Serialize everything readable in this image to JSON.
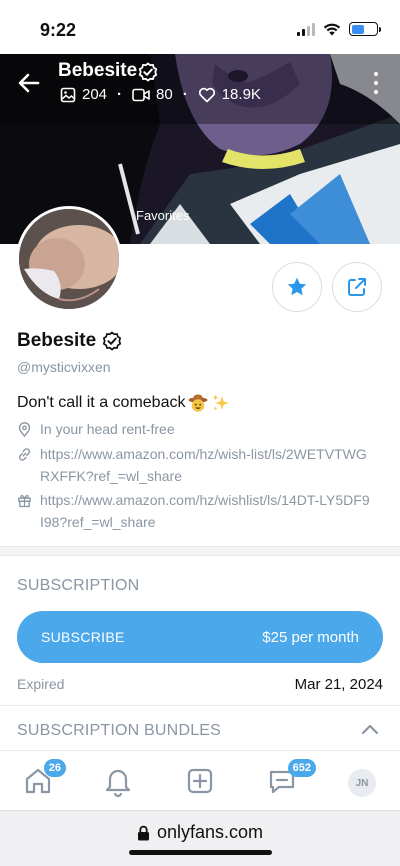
{
  "status_bar": {
    "time": "9:22"
  },
  "header": {
    "name": "Bebesite",
    "stats": {
      "photos": "204",
      "videos": "80",
      "likes": "18.9K"
    },
    "overlay_label": "Favorites"
  },
  "profile": {
    "name": "Bebesite",
    "handle": "@mysticvixxen",
    "bio": "Don't call it a comeback",
    "location": "In your head rent-free",
    "link1": "https://www.amazon.com/hz/wish-list/ls/2WETVTWGRXFFK?ref_=wl_share",
    "link2": "https://www.amazon.com/hz/wishlist/ls/14DT-LY5DF9I98?ref_=wl_share"
  },
  "subscription": {
    "title": "SUBSCRIPTION",
    "button_label": "SUBSCRIBE",
    "price": "$25 per month",
    "expired_label": "Expired",
    "expired_date": "Mar 21, 2024"
  },
  "bundles": {
    "title": "SUBSCRIPTION BUNDLES"
  },
  "bottom_nav": {
    "home_badge": "26",
    "messages_badge": "652",
    "user_initials": "JN"
  },
  "browser": {
    "domain": "onlyfans.com"
  },
  "colors": {
    "accent": "#00aff0",
    "button_blue": "#4ba8ea",
    "muted_text": "#8a96a3"
  },
  "icons": [
    "back-arrow-icon",
    "verified-icon",
    "image-icon",
    "video-icon",
    "heart-icon",
    "more-vertical-icon",
    "star-icon",
    "share-icon",
    "location-icon",
    "link-icon",
    "gift-icon",
    "chevron-up-icon",
    "home-icon",
    "bell-icon",
    "plus-square-icon",
    "message-icon",
    "lock-icon"
  ]
}
